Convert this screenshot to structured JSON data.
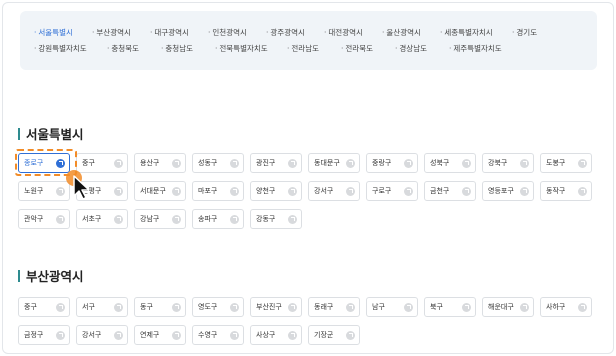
{
  "regions": {
    "row1": [
      "서울특별시",
      "부산광역시",
      "대구광역시",
      "인천광역시",
      "광주광역시",
      "대전광역시",
      "울산광역시",
      "세종특별자치시",
      "경기도"
    ],
    "row2": [
      "강원특별자치도",
      "충청북도",
      "충청남도",
      "전북특별자치도",
      "전라남도",
      "전라북도",
      "경상남도",
      "제주특별자치도"
    ],
    "active": "서울특별시"
  },
  "seoul": {
    "title": "서울특별시",
    "rows": [
      [
        "종로구",
        "중구",
        "용산구",
        "성동구",
        "광진구",
        "동대문구",
        "중랑구",
        "성북구",
        "강북구",
        "도봉구"
      ],
      [
        "노원구",
        "은평구",
        "서대문구",
        "마포구",
        "양천구",
        "강서구",
        "구로구",
        "금천구",
        "영등포구",
        "동작구"
      ],
      [
        "관악구",
        "서초구",
        "강남구",
        "송파구",
        "강동구"
      ]
    ],
    "selected": "종로구"
  },
  "busan": {
    "title": "부산광역시",
    "rows": [
      [
        "중구",
        "서구",
        "동구",
        "영도구",
        "부산진구",
        "동래구",
        "남구",
        "북구",
        "해운대구",
        "사하구"
      ],
      [
        "금정구",
        "강서구",
        "연제구",
        "수영구",
        "사상구",
        "기장군"
      ]
    ]
  },
  "icons": {
    "chip_action": "external-link-icon",
    "pointer": "mouse-cursor-icon"
  },
  "colors": {
    "accent": "#2f6fd6",
    "section_bar": "#2e8b8f",
    "focus_ring": "#f28c28",
    "region_bg": "#f0f4f8"
  }
}
